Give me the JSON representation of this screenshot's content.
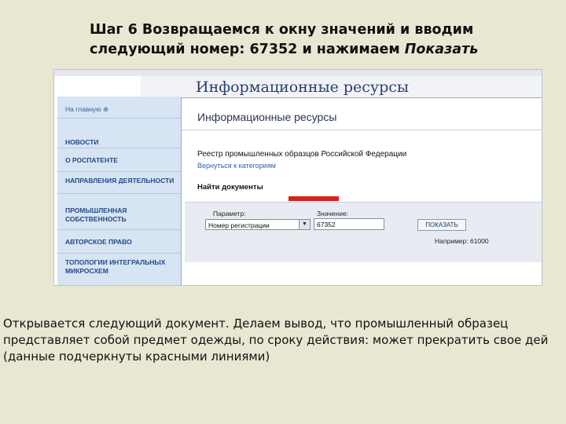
{
  "heading": {
    "line1": "Шаг 6 Возвращаемся к окну значений и вводим",
    "line2_main": "следующий номер: 67352 и нажимаем ",
    "line2_em": "Показать"
  },
  "background_window": {
    "title": "Информационные ресурсы",
    "sidebar": {
      "home": "На главную  ⊕",
      "items": [
        "НОВОСТИ",
        "О РОСПАТЕНТЕ",
        "НАПРАВЛЕНИЯ ДЕЯТЕЛЬНОСТИ",
        "ПРОМЫШЛЕННАЯ СОБСТВЕННОСТЬ",
        "АВТОРСКОЕ ПРАВО",
        "ТОПОЛОГИИ ИНТЕГРАЛЬНЫХ МИКРОСХЕМ"
      ]
    }
  },
  "front_window": {
    "title": "Информационные ресурсы",
    "registry_title": "Реестр промышленных образцов Российской Федерации",
    "back_link": "Вернуться к категориям",
    "find_heading": "Найти документы",
    "param_label": "Параметр:",
    "param_value": "Номер регистрации",
    "value_label": "Значение:",
    "value_input": "67352",
    "show_button": "ПОКАЗАТЬ",
    "example": "Например: 61000"
  },
  "body_text": {
    "line1": "Открывается следующий документ. Делаем вывод, что промышленный образец",
    "line2": " представляет собой предмет одежды, по сроку действия: может прекратить свое дей",
    "line3": "(данные подчеркнуты красными линиями)"
  },
  "colors": {
    "slide_background": "#e9e7d2",
    "sidebar": "#d7e4f3",
    "link": "#3060a8",
    "marker": "#d92020"
  }
}
